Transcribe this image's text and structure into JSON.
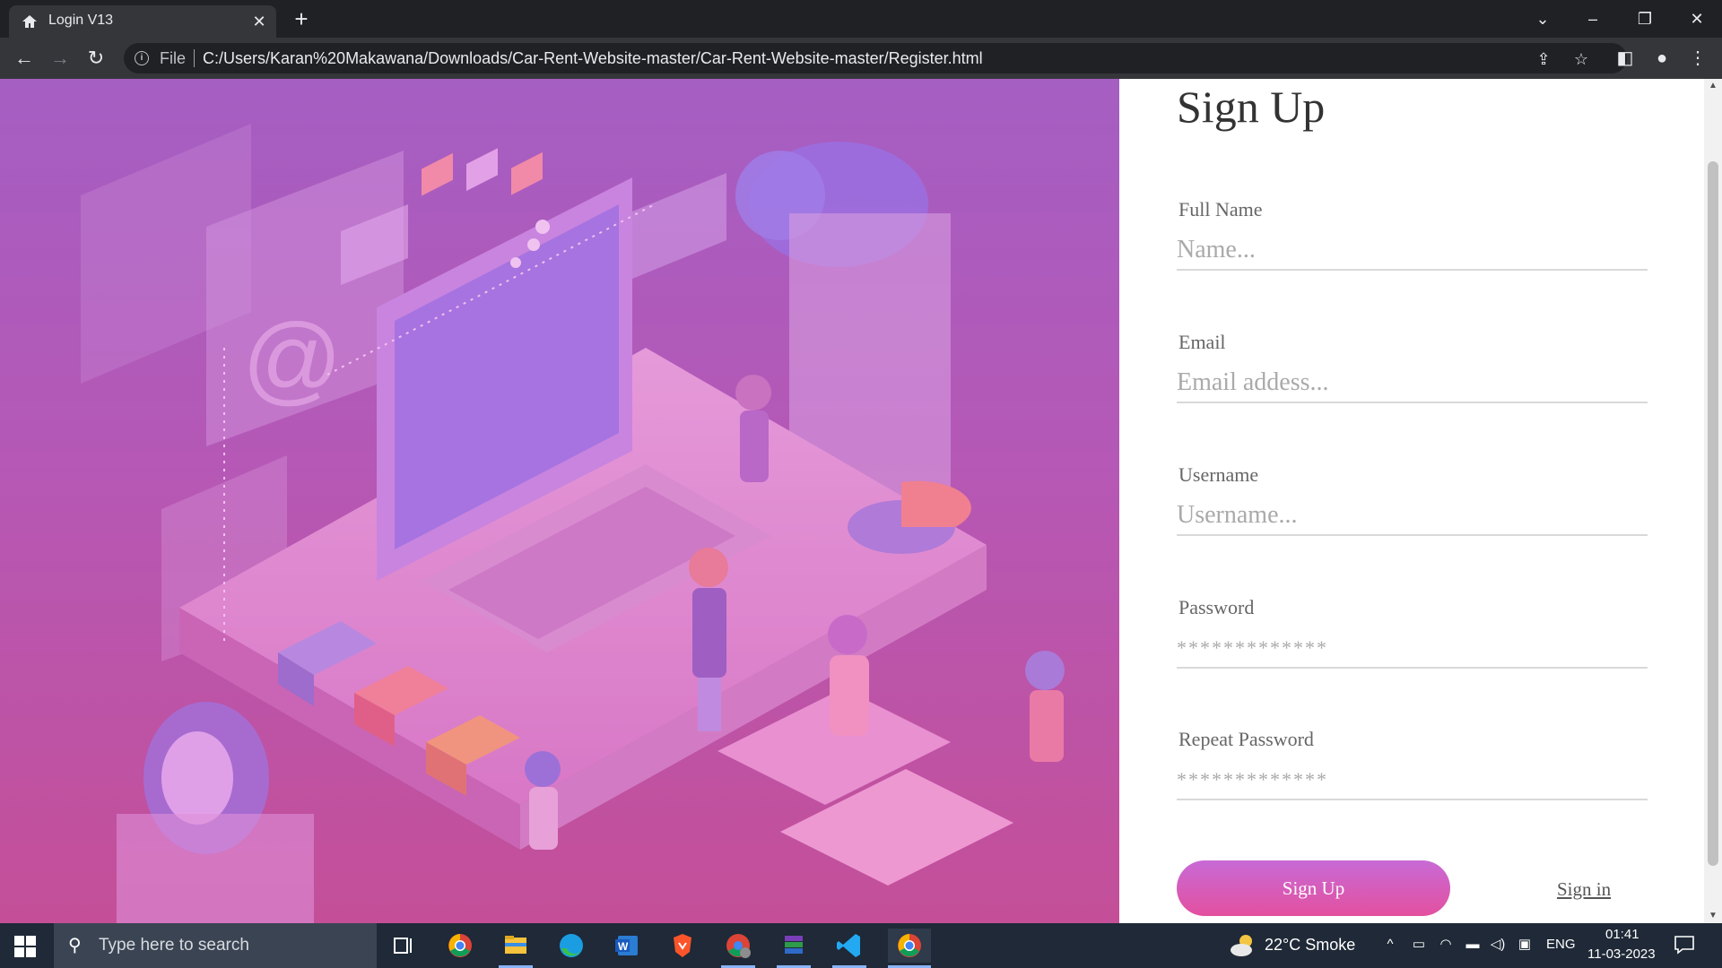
{
  "browser": {
    "tab_title": "Login V13",
    "file_label": "File",
    "url": "C:/Users/Karan%20Makawana/Downloads/Car-Rent-Website-master/Car-Rent-Website-master/Register.html"
  },
  "form": {
    "title": "Sign Up",
    "fields": [
      {
        "label": "Full Name",
        "placeholder": "Name...",
        "value": ""
      },
      {
        "label": "Email",
        "placeholder": "Email addess...",
        "value": ""
      },
      {
        "label": "Username",
        "placeholder": "Username...",
        "value": ""
      },
      {
        "label": "Password",
        "placeholder": "*************",
        "value": ""
      },
      {
        "label": "Repeat Password",
        "placeholder": "*************",
        "value": ""
      }
    ],
    "submit_label": "Sign Up",
    "signin_label": "Sign in"
  },
  "colors": {
    "hero_top": "#a55ec2",
    "hero_bottom": "#c44f98",
    "button_top": "#c86ad6",
    "button_bottom": "#e3509f"
  },
  "taskbar": {
    "search_placeholder": "Type here to search",
    "apps": [
      "task-view-icon",
      "chrome-icon",
      "file-explorer-icon",
      "edge-icon",
      "word-icon",
      "brave-icon",
      "chrome-profile-icon",
      "winrar-icon",
      "vscode-icon",
      "chrome-active-icon"
    ],
    "weather": "22°C  Smoke",
    "language": "ENG",
    "time": "01:41",
    "date": "11-03-2023"
  }
}
